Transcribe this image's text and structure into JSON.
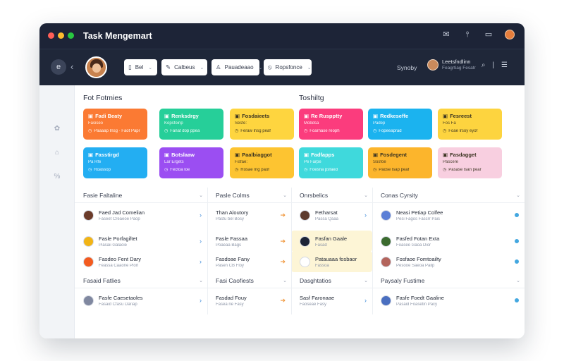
{
  "window": {
    "title": "Task Mengemart"
  },
  "toolbar": {
    "circle_button": "e",
    "filters": [
      {
        "icon": "doc-icon",
        "glyph": "▯",
        "label": "Bel"
      },
      {
        "icon": "pen-icon",
        "glyph": "✎",
        "label": "Calbeus"
      },
      {
        "icon": "user-icon",
        "glyph": "♙",
        "label": "Pauadeaao"
      },
      {
        "icon": "clip-icon",
        "glyph": "⦸",
        "label": "Ropsfonce"
      }
    ],
    "search_label": "Synoby",
    "user": {
      "name": "Leetsfndlinn",
      "subtitle": "Feagrtiag Fesatr"
    }
  },
  "sections": {
    "left_title": "Fot Fotmies",
    "right_title": "Toshiltg"
  },
  "cards": [
    {
      "color": "#fb7a33",
      "title": "Fadi Beaty",
      "sub": "Fasiseo",
      "foot": "Paaaap Insg · Faot Papr",
      "dark": false
    },
    {
      "color": "#26cf99",
      "title": "Renksdrgy",
      "sub": "Kopsfoinp",
      "foot": "Fanat dop ppea",
      "dark": false
    },
    {
      "color": "#fed53f",
      "title": "Fosdaieets",
      "sub": "Sesfe:",
      "foot": "Feraw lnsg peaf",
      "dark": true
    },
    {
      "color": "#fb3c7d",
      "title": "Re Ruspptty",
      "sub": "Mobdsa",
      "foot": "Foarnaxe reoph",
      "dark": false
    },
    {
      "color": "#1bb3ef",
      "title": "Redkeseffe",
      "sub": "Padep",
      "foot": "Fopeeaprad",
      "dark": false
    },
    {
      "color": "#fdd43f",
      "title": "Fesreest",
      "sub": "Fos Fa",
      "foot": "Foae lrsoy eyof",
      "dark": true
    },
    {
      "color": "#23aef2",
      "title": "Fasstirgd",
      "sub": "Pa Rfe",
      "foot": "Roassop",
      "dark": false
    },
    {
      "color": "#9b4ef2",
      "title": "Botslaaw",
      "sub": "Lar Ergets",
      "foot": "Fectoa loe",
      "dark": false
    },
    {
      "color": "#fdc431",
      "title": "Paalbiaggot",
      "sub": "Fisfae:",
      "foot": "Rosae Ing paof",
      "dark": true
    },
    {
      "color": "#3fd9dc",
      "title": "Fadfapps",
      "sub": "Pe Farpe",
      "foot": "Foesna psfaed",
      "dark": false
    },
    {
      "color": "#fcb52c",
      "title": "Fosdegent",
      "sub": "Sosfoe",
      "foot": "Paose lsap peaf",
      "dark": true
    },
    {
      "color": "#f8cfe0",
      "title": "Fasdagget",
      "sub": "Pascere",
      "foot": "Pasase lsan pear",
      "dark": true
    }
  ],
  "lists": [
    {
      "title": "Fasie Faltaline",
      "rows": [
        {
          "avatar": "#6b3b2a",
          "t1": "Faed Jad Comelian",
          "t2": "Faseet Creaeoe Paop"
        },
        {
          "avatar": "#f2b416",
          "t1": "Fasle Porfagiftet",
          "t2": "Piasaii Galaoie"
        },
        {
          "avatar": "#f35b1f",
          "t1": "Fasdeo Fent Dary",
          "t2": "Feassa Caaone Plorl"
        }
      ]
    },
    {
      "title": "Pasle Colms",
      "rows": [
        {
          "avatar": "",
          "t1": "Than Aloutory",
          "t2": "Pastu bel Bosy"
        },
        {
          "avatar": "",
          "t1": "Fasle Fassaa",
          "t2": "Poaeaa Bags"
        },
        {
          "avatar": "",
          "t1": "Fasdoae Fany",
          "t2": "Pasen CB Floy"
        }
      ]
    },
    {
      "title": "Onrsbelics",
      "rows": [
        {
          "avatar": "#5c3a2e",
          "t1": "Fetharsat",
          "t2": "Passa Qaaa"
        },
        {
          "avatar": "#1d2437",
          "t1": "Fasfan Gaale",
          "t2": "Fasad"
        },
        {
          "avatar": "#ffffff",
          "t1": "Patauaaa fosbaor",
          "t2": "Fassoa"
        }
      ]
    },
    {
      "title": "Conas Cyrsity",
      "rows": [
        {
          "avatar": "#5b7fd6",
          "t1": "Neasi Petiap Colfee",
          "t2": "Pesi Fagos Fascrr Pais"
        },
        {
          "avatar": "#3b6b2f",
          "t1": "Fasfed Fotan Exta",
          "t2": "Foasee Gaoa Dior"
        },
        {
          "avatar": "#b3645c",
          "t1": "Fosfaoe Fomtoailty",
          "t2": "Pesooe Saeoa Pailp"
        }
      ]
    },
    {
      "title": "Fasaid Fatlies",
      "rows": [
        {
          "avatar": "#8088a0",
          "t1": "Fasfe Caesetaoles",
          "t2": "Fasaid Cfasu Dariap"
        }
      ]
    },
    {
      "title": "Fasi Caofiests",
      "rows": [
        {
          "avatar": "",
          "t1": "Fasdad Fouy",
          "t2": "Fasea ne Fasy"
        }
      ]
    },
    {
      "title": "Dasghtatios",
      "rows": [
        {
          "avatar": "",
          "t1": "Sasf Faronaae",
          "t2": "Faoseae Fasy"
        }
      ]
    },
    {
      "title": "Paysaly Fustime",
      "rows": [
        {
          "avatar": "#4a6fc0",
          "t1": "Fasfe Foedt Gaaline",
          "t2": "Pasaid Foasetin Pacy"
        }
      ]
    }
  ]
}
